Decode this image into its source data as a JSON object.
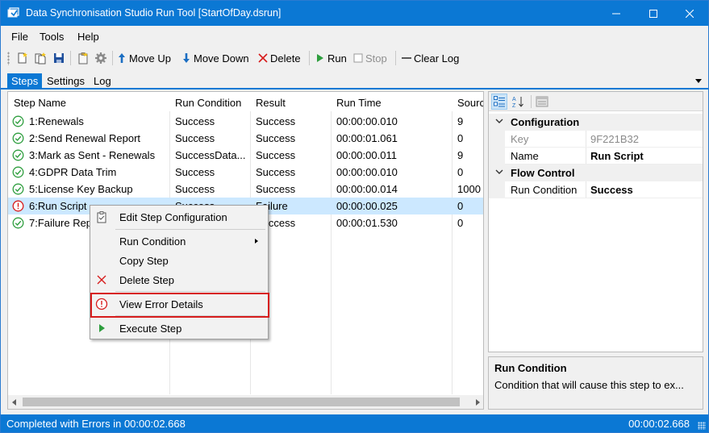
{
  "window": {
    "title": "Data Synchronisation Studio Run Tool [StartOfDay.dsrun]"
  },
  "menu": {
    "file": "File",
    "tools": "Tools",
    "help": "Help"
  },
  "toolbar": {
    "move_up": "Move Up",
    "move_down": "Move Down",
    "delete": "Delete",
    "run": "Run",
    "stop": "Stop",
    "clear_log": "Clear Log"
  },
  "tabs": {
    "steps": "Steps",
    "settings": "Settings",
    "log": "Log"
  },
  "steps_list": {
    "columns": [
      "Step Name",
      "Run Condition",
      "Result",
      "Run Time",
      "Sourc"
    ],
    "rows": [
      {
        "name": "1:Renewals",
        "condition": "Success",
        "result": "Success",
        "time": "00:00:00.010",
        "source": "9",
        "status": "ok"
      },
      {
        "name": "2:Send Renewal Report",
        "condition": "Success",
        "result": "Success",
        "time": "00:00:01.061",
        "source": "0",
        "status": "ok"
      },
      {
        "name": "3:Mark as Sent - Renewals",
        "condition": "SuccessData...",
        "result": "Success",
        "time": "00:00:00.011",
        "source": "9",
        "status": "ok"
      },
      {
        "name": "4:GDPR Data Trim",
        "condition": "Success",
        "result": "Success",
        "time": "00:00:00.010",
        "source": "0",
        "status": "ok"
      },
      {
        "name": "5:License Key Backup",
        "condition": "Success",
        "result": "Success",
        "time": "00:00:00.014",
        "source": "1000",
        "status": "ok"
      },
      {
        "name": "6:Run Script",
        "condition": "Success",
        "result": "Failure",
        "time": "00:00:00.025",
        "source": "0",
        "status": "error"
      },
      {
        "name": "7:Failure Report",
        "condition": "Success",
        "result": "Success",
        "time": "00:00:01.530",
        "source": "0",
        "status": "ok"
      }
    ]
  },
  "context_menu": {
    "edit_config": "Edit Step Configuration",
    "run_condition": "Run Condition",
    "copy_step": "Copy Step",
    "delete_step": "Delete Step",
    "view_error": "View Error Details",
    "execute_step": "Execute Step"
  },
  "properties": {
    "cat_configuration": "Configuration",
    "key_label": "Key",
    "key_value": "9F221B32",
    "name_label": "Name",
    "name_value": "Run Script",
    "cat_flow": "Flow Control",
    "run_condition_label": "Run Condition",
    "run_condition_value": "Success"
  },
  "help": {
    "title": "Run Condition",
    "description": "Condition that will cause this step to ex..."
  },
  "status": {
    "left": "Completed with Errors in 00:00:02.668",
    "right": "00:00:02.668"
  },
  "colors": {
    "accent": "#0b78d4",
    "success": "#2e9e3e",
    "error": "#d71c1c",
    "selected_row": "#cce8ff"
  }
}
